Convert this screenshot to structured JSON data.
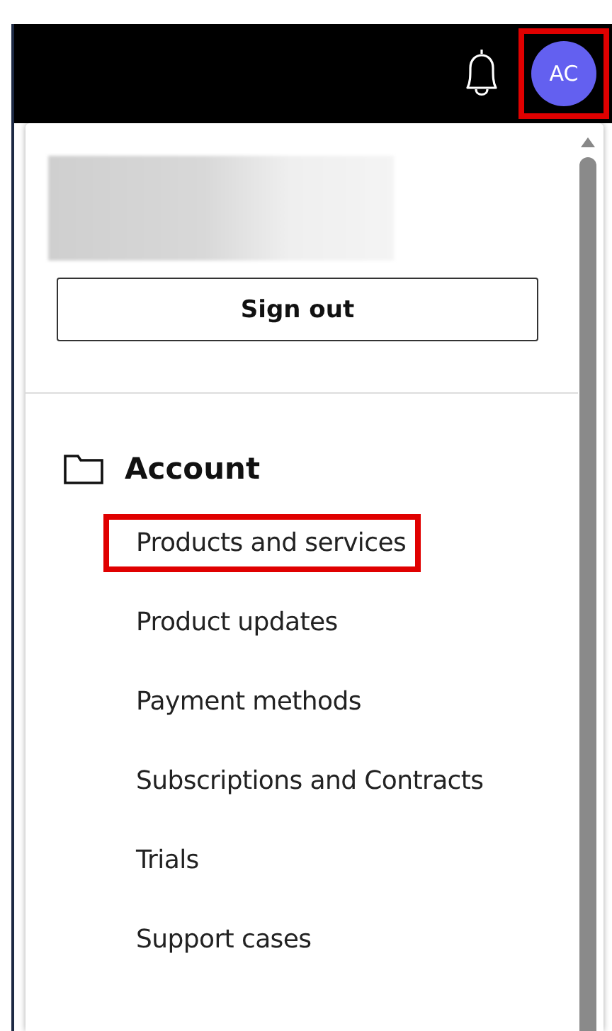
{
  "header": {
    "avatar": {
      "initials": "AC",
      "highlighted": true
    }
  },
  "account_menu": {
    "sign_out": "Sign out",
    "section": {
      "label": "Account"
    },
    "items": [
      {
        "label": "Products and services",
        "highlighted": true
      },
      {
        "label": "Product updates",
        "highlighted": false
      },
      {
        "label": "Payment methods",
        "highlighted": false
      },
      {
        "label": "Subscriptions and Contracts",
        "highlighted": false
      },
      {
        "label": "Trials",
        "highlighted": false
      },
      {
        "label": "Support cases",
        "highlighted": false
      }
    ]
  }
}
